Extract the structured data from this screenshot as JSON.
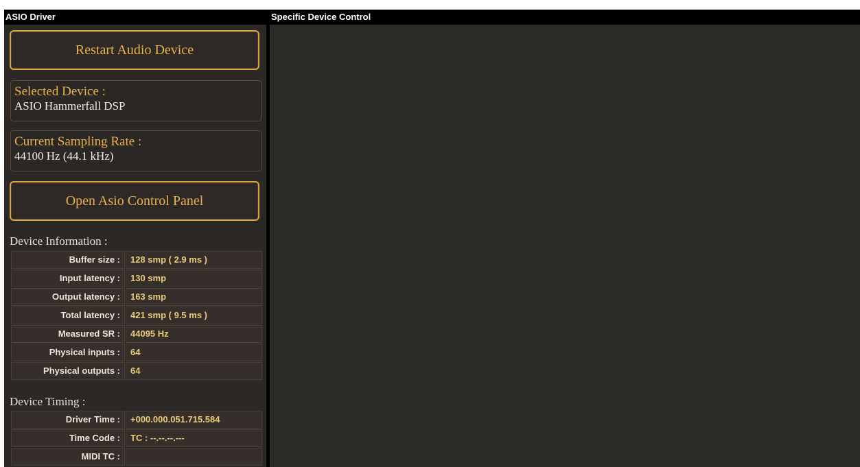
{
  "left_panel": {
    "title": "ASIO Driver"
  },
  "right_panel": {
    "title": "Specific Device Control"
  },
  "buttons": {
    "restart": "Restart Audio Device",
    "open_panel": "Open Asio Control Panel"
  },
  "selected_device": {
    "label": "Selected Device :",
    "value": "ASIO Hammerfall DSP"
  },
  "sampling_rate": {
    "label": "Current Sampling Rate :",
    "value": "44100 Hz (44.1 kHz)"
  },
  "device_information": {
    "title": "Device Information :",
    "rows": [
      {
        "key": "Buffer size :",
        "value": "128 smp ( 2.9 ms )"
      },
      {
        "key": "Input latency :",
        "value": "130 smp"
      },
      {
        "key": "Output latency :",
        "value": "163 smp"
      },
      {
        "key": "Total latency :",
        "value": "421 smp ( 9.5 ms )"
      },
      {
        "key": "Measured SR :",
        "value": "44095 Hz"
      },
      {
        "key": "Physical inputs :",
        "value": "64"
      },
      {
        "key": "Physical outputs :",
        "value": "64"
      }
    ]
  },
  "device_timing": {
    "title": "Device Timing :",
    "rows": [
      {
        "key": "Driver Time :",
        "value": "+000.000.051.715.584"
      },
      {
        "key": "Time Code :",
        "value": "TC : --.--.--.---"
      },
      {
        "key": "MIDI TC :",
        "value": ""
      }
    ]
  },
  "colors": {
    "accent": "#e8b24a",
    "value_text": "#e8cc7a",
    "panel_bg": "#2c2826"
  }
}
